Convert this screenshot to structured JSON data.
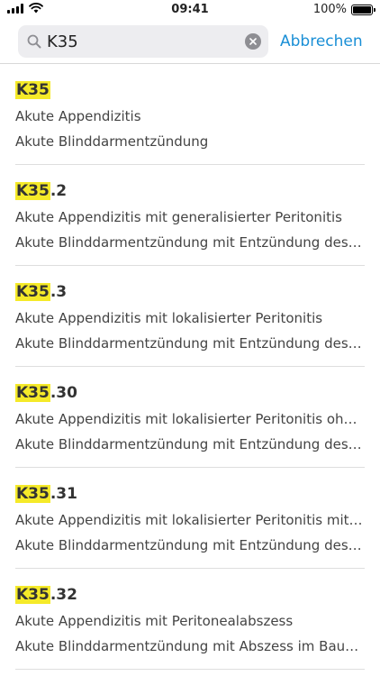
{
  "status": {
    "time": "09:41",
    "battery": "100%",
    "battery_level": 1.0
  },
  "search": {
    "value": "K35",
    "cancel_label": "Abbrechen"
  },
  "results": [
    {
      "highlight": "K35",
      "suffix": "",
      "line1": "Akute Appendizitis",
      "line2": "Akute Blinddarmentzündung"
    },
    {
      "highlight": "K35",
      "suffix": ".2",
      "line1": "Akute Appendizitis mit generalisierter Peritonitis",
      "line2": "Akute Blinddarmentzündung mit Entzündung des gesamten Bauchfells"
    },
    {
      "highlight": "K35",
      "suffix": ".3",
      "line1": "Akute Appendizitis mit lokalisierter Peritonitis",
      "line2": "Akute Blinddarmentzündung mit Entzündung des durch den Blinddarm begrenzten Bauchfells"
    },
    {
      "highlight": "K35",
      "suffix": ".30",
      "line1": "Akute Appendizitis mit lokalisierter Peritonitis ohne Perforation oder Ruptur",
      "line2": "Akute Blinddarmentzündung mit Entzündung des durch den Blinddarm begrenzten Bauchfells"
    },
    {
      "highlight": "K35",
      "suffix": ".31",
      "line1": "Akute Appendizitis mit lokalisierter Peritonitis mit Perforation oder Ruptur",
      "line2": "Akute Blinddarmentzündung mit Entzündung des durch den Blinddarm begrenzten Bauchfells"
    },
    {
      "highlight": "K35",
      "suffix": ".32",
      "line1": "Akute Appendizitis mit Peritonealabszess",
      "line2": "Akute Blinddarmentzündung mit Abszess im Bauchraum"
    }
  ]
}
